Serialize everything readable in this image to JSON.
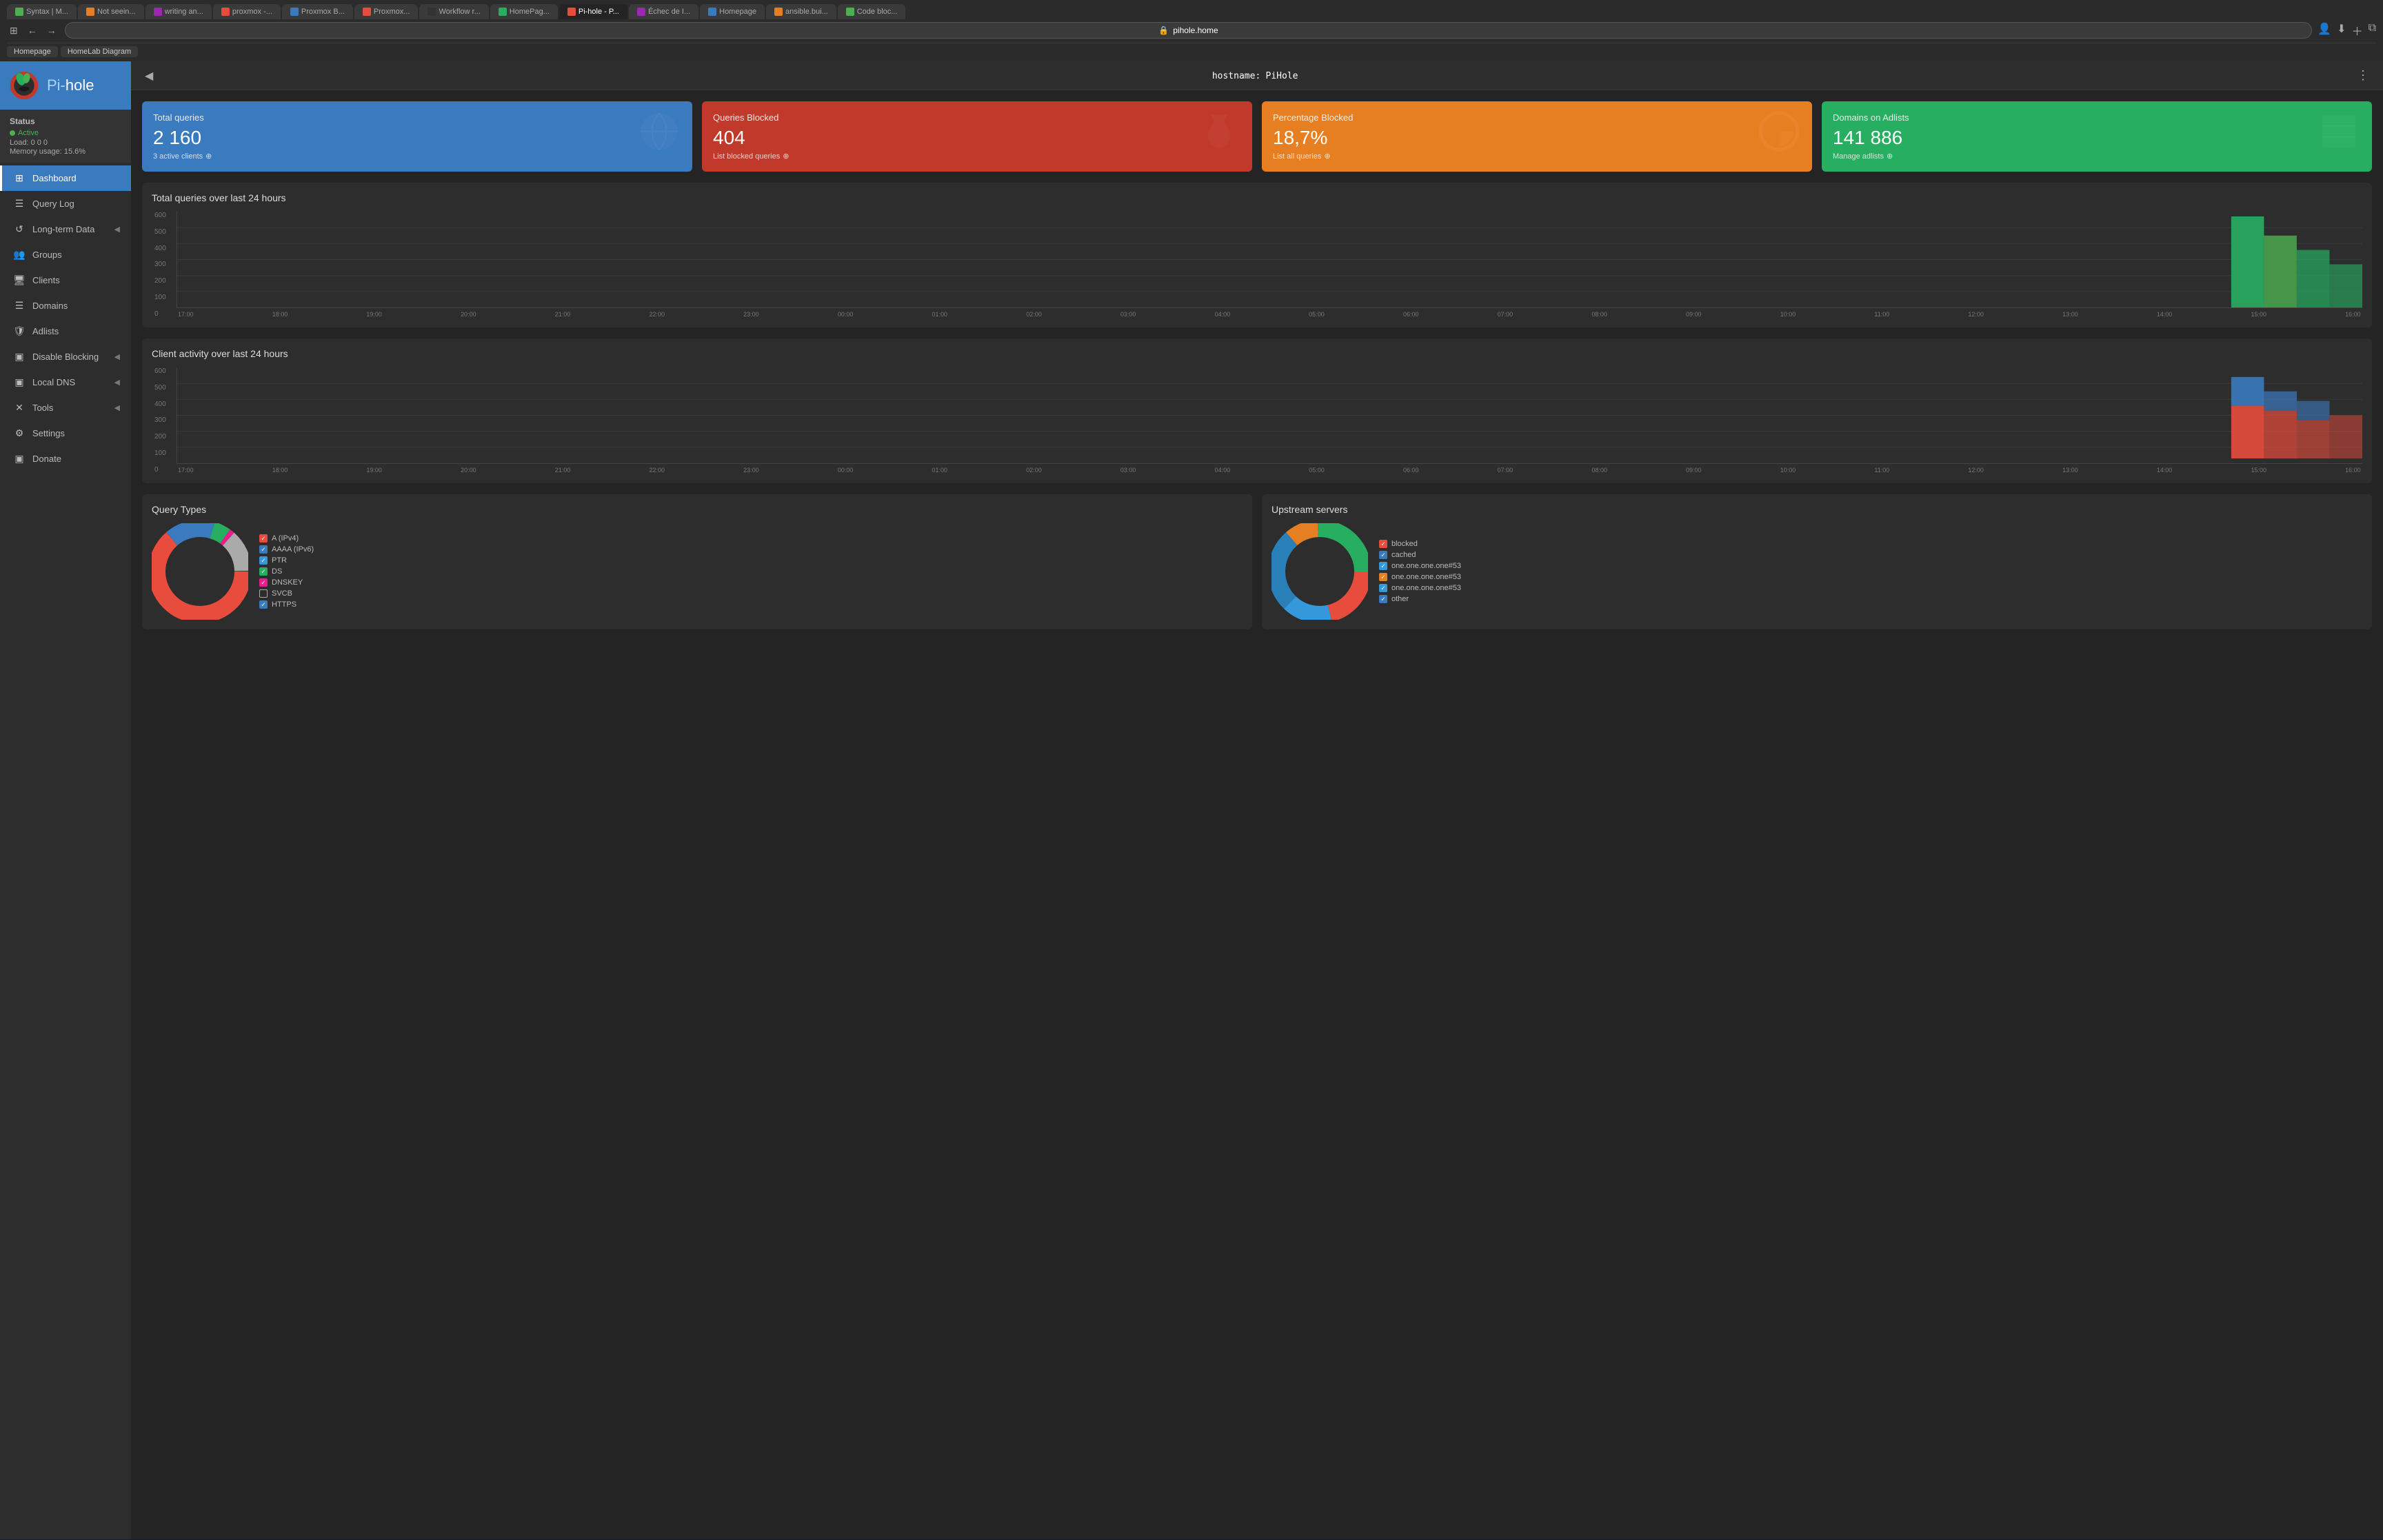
{
  "browser": {
    "address": "pihole.home",
    "bookmarks": [
      "Homepage",
      "HomeLab Diagram"
    ],
    "tabs": [
      {
        "label": "Syntax | M...",
        "favicon_color": "#4CAF50",
        "active": false
      },
      {
        "label": "Not seein...",
        "favicon_color": "#e67e22",
        "active": false
      },
      {
        "label": "writing an...",
        "favicon_color": "#9C27B0",
        "active": false
      },
      {
        "label": "proxmox -...",
        "favicon_color": "#e74c3c",
        "active": false
      },
      {
        "label": "Proxmox B...",
        "favicon_color": "#3a7abf",
        "active": false
      },
      {
        "label": "Proxmox...",
        "favicon_color": "#e74c3c",
        "active": false
      },
      {
        "label": "Workflow r...",
        "favicon_color": "#333",
        "active": false
      },
      {
        "label": "HomePag...",
        "favicon_color": "#27ae60",
        "active": false
      },
      {
        "label": "Pi-hole - P...",
        "favicon_color": "#e74c3c",
        "active": true
      },
      {
        "label": "Échec de I...",
        "favicon_color": "#9C27B0",
        "active": false
      },
      {
        "label": "Homepage",
        "favicon_color": "#3a7abf",
        "active": false
      },
      {
        "label": "ansible.bui...",
        "favicon_color": "#e67e22",
        "active": false
      },
      {
        "label": "Code bloc...",
        "favicon_color": "#4CAF50",
        "active": false
      }
    ]
  },
  "sidebar": {
    "title_prefix": "Pi-",
    "title_suffix": "hole",
    "status": {
      "label": "Status",
      "active": "Active",
      "load": "Load: 0 0 0",
      "memory": "Memory usage: 15.6%"
    },
    "nav": [
      {
        "label": "Dashboard",
        "icon": "⊞",
        "active": true
      },
      {
        "label": "Query Log",
        "icon": "☰",
        "active": false
      },
      {
        "label": "Long-term Data",
        "icon": "↺",
        "active": false,
        "arrow": true
      },
      {
        "label": "Groups",
        "icon": "👥",
        "active": false
      },
      {
        "label": "Clients",
        "icon": "🖥",
        "active": false
      },
      {
        "label": "Domains",
        "icon": "☰",
        "active": false
      },
      {
        "label": "Adlists",
        "icon": "🛡",
        "active": false
      },
      {
        "label": "Disable Blocking",
        "icon": "▣",
        "active": false,
        "arrow": true
      },
      {
        "label": "Local DNS",
        "icon": "▣",
        "active": false,
        "arrow": true
      },
      {
        "label": "Tools",
        "icon": "✕",
        "active": false,
        "arrow": true
      },
      {
        "label": "Settings",
        "icon": "⚙",
        "active": false
      },
      {
        "label": "Donate",
        "icon": "▣",
        "active": false
      }
    ]
  },
  "header": {
    "hostname_label": "hostname:",
    "hostname_value": "PiHole"
  },
  "stats": [
    {
      "label": "Total queries",
      "value": "2 160",
      "link": "3 active clients",
      "color": "blue",
      "icon": "🌐"
    },
    {
      "label": "Queries Blocked",
      "value": "404",
      "link": "List blocked queries",
      "color": "red",
      "icon": "✋"
    },
    {
      "label": "Percentage Blocked",
      "value": "18,7%",
      "link": "List all queries",
      "color": "orange",
      "icon": "◕"
    },
    {
      "label": "Domains on Adlists",
      "value": "141 886",
      "link": "Manage adlists",
      "color": "green",
      "icon": "≡"
    }
  ],
  "chart1": {
    "title": "Total queries over last 24 hours",
    "y_labels": [
      "600",
      "500",
      "400",
      "300",
      "200",
      "100",
      "0"
    ],
    "x_labels": [
      "17:00",
      "18:00",
      "19:00",
      "20:00",
      "21:00",
      "22:00",
      "23:00",
      "00:00",
      "01:00",
      "02:00",
      "03:00",
      "04:00",
      "05:00",
      "06:00",
      "07:00",
      "08:00",
      "09:00",
      "10:00",
      "11:00",
      "12:00",
      "13:00",
      "14:00",
      "15:00",
      "16:00"
    ]
  },
  "chart2": {
    "title": "Client activity over last 24 hours",
    "y_labels": [
      "600",
      "500",
      "400",
      "300",
      "200",
      "100",
      "0"
    ],
    "x_labels": [
      "17:00",
      "18:00",
      "19:00",
      "20:00",
      "21:00",
      "22:00",
      "23:00",
      "00:00",
      "01:00",
      "02:00",
      "03:00",
      "04:00",
      "05:00",
      "06:00",
      "07:00",
      "08:00",
      "09:00",
      "10:00",
      "11:00",
      "12:00",
      "13:00",
      "14:00",
      "15:00",
      "16:00"
    ]
  },
  "query_types": {
    "title": "Query Types",
    "legend": [
      {
        "label": "A (IPv4)",
        "color": "#e74c3c",
        "checked": true
      },
      {
        "label": "AAAA (IPv6)",
        "color": "#3a7abf",
        "checked": true
      },
      {
        "label": "PTR",
        "color": "#3498db",
        "checked": true
      },
      {
        "label": "DS",
        "color": "#27ae60",
        "checked": true
      },
      {
        "label": "DNSKEY",
        "color": "#e91e8c",
        "checked": true
      },
      {
        "label": "SVCB",
        "color": "#aaa",
        "checked": false
      },
      {
        "label": "HTTPS",
        "color": "#3a7abf",
        "checked": true
      }
    ]
  },
  "upstream_servers": {
    "title": "Upstream servers",
    "legend": [
      {
        "label": "blocked",
        "color": "#e74c3c",
        "checked": true
      },
      {
        "label": "cached",
        "color": "#3a7abf",
        "checked": true
      },
      {
        "label": "one.one.one.one#53",
        "color": "#3498db",
        "checked": true
      },
      {
        "label": "one.one.one.one#53",
        "color": "#e67e22",
        "checked": true
      },
      {
        "label": "one.one.one.one#53",
        "color": "#3498db",
        "checked": true
      },
      {
        "label": "other",
        "color": "#3a7abf",
        "checked": true
      }
    ]
  }
}
